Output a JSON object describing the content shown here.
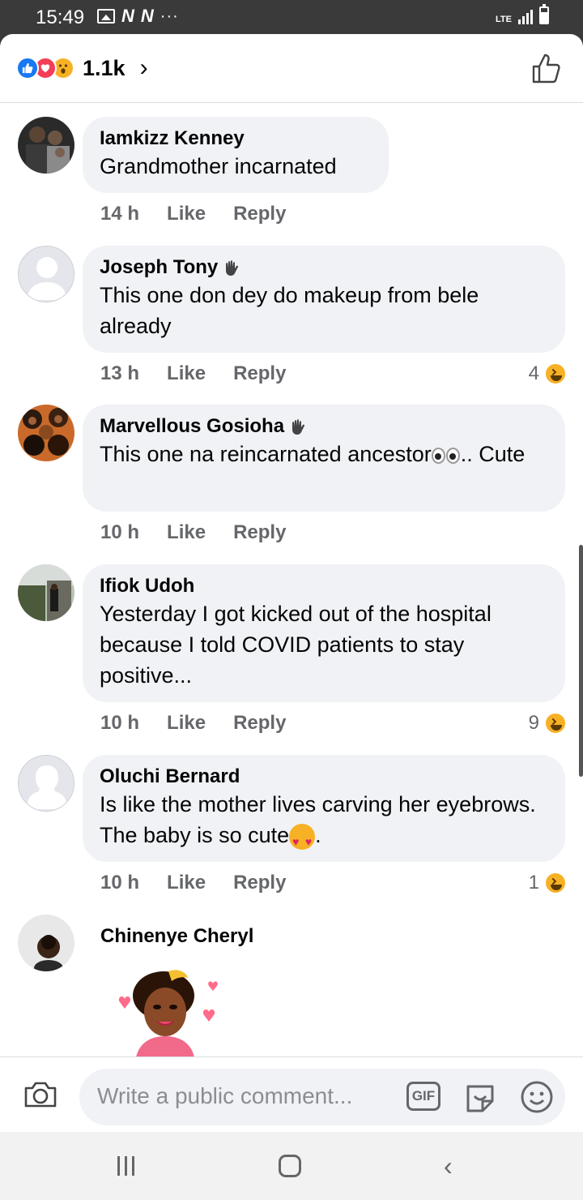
{
  "status_bar": {
    "time": "15:49",
    "network": "LTE",
    "dots": "···"
  },
  "header": {
    "reaction_count": "1.1k",
    "chevron": "›",
    "reactions": [
      "like-icon",
      "love-icon",
      "wow-icon"
    ]
  },
  "comments": [
    {
      "name": "Iamkizz Kenney",
      "text": "Grandmother incarnated",
      "time": "14 h",
      "like": "Like",
      "reply": "Reply",
      "reaction_count": ""
    },
    {
      "name": "Joseph Tony",
      "text": "This one don dey do makeup from bele already",
      "time": "13 h",
      "like": "Like",
      "reply": "Reply",
      "reaction_count": "4"
    },
    {
      "name": "Marvellous Gosioha",
      "text": "This one na reincarnated ancestor",
      "text_suffix": ".. Cute",
      "time": "10 h",
      "like": "Like",
      "reply": "Reply",
      "reaction_count": ""
    },
    {
      "name": "Ifiok Udoh",
      "text": "Yesterday I got kicked out of the hospital because I told COVID patients to stay positive...",
      "time": "10 h",
      "like": "Like",
      "reply": "Reply",
      "reaction_count": "9"
    },
    {
      "name": "Oluchi Bernard",
      "text": "Is like the mother lives carving her eyebrows. The baby is so cute",
      "text_suffix": ".",
      "time": "10 h",
      "like": "Like",
      "reply": "Reply",
      "reaction_count": "1"
    },
    {
      "name": "Chinenye Cheryl"
    }
  ],
  "composer": {
    "placeholder": "Write a public comment...",
    "gif_label": "GIF"
  },
  "colors": {
    "bubble": "#f0f2f5",
    "meta_text": "#65676b",
    "like_blue": "#1877f2",
    "love_red": "#f33e58",
    "haha_yellow": "#f7b125"
  }
}
